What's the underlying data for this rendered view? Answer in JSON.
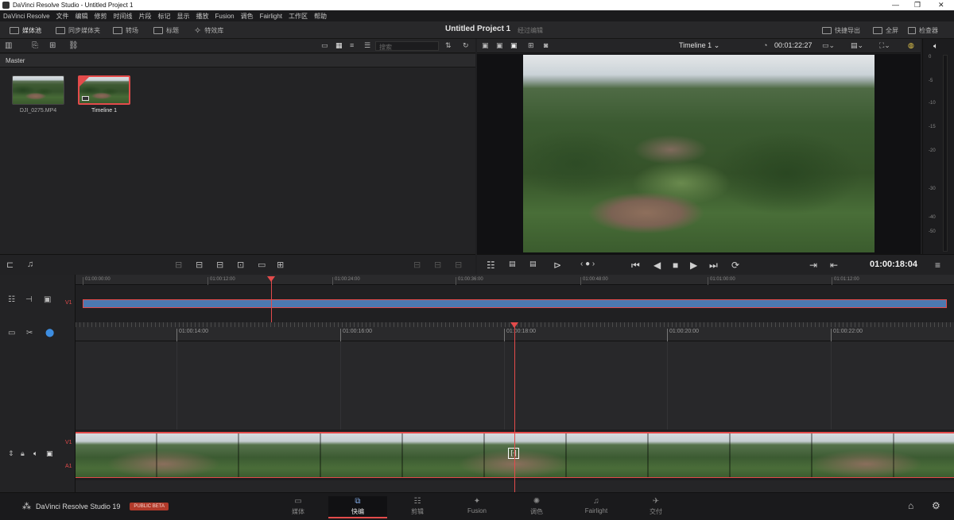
{
  "window": {
    "title": "DaVinci Resolve Studio - Untitled Project 1"
  },
  "menu": [
    "DaVinci Resolve",
    "文件",
    "编辑",
    "修剪",
    "时间线",
    "片段",
    "标记",
    "显示",
    "播放",
    "Fusion",
    "调色",
    "Fairlight",
    "工作区",
    "帮助"
  ],
  "toolbar": {
    "media_pool": "媒体池",
    "sync_bin": "同步媒体夹",
    "transitions": "转场",
    "titles": "标题",
    "effects": "特效库",
    "project_title": "Untitled Project 1",
    "project_sub": "经过编辑",
    "quick_export": "快捷导出",
    "fullscreen": "全屏",
    "inspector": "检查器"
  },
  "media_pool": {
    "search_placeholder": "搜索",
    "path": "Master",
    "clips": [
      {
        "name": "DJI_0275.MP4"
      },
      {
        "name": "Timeline 1"
      }
    ]
  },
  "viewer": {
    "timeline_name": "Timeline 1",
    "duration": "00:01:22:27",
    "timecode": "01:00:18:04",
    "scale": [
      "0",
      "-5",
      "-10",
      "-15",
      "-20",
      "-30",
      "-40",
      "-50"
    ]
  },
  "upper_timeline": {
    "track": "V1",
    "ticks": [
      "01:00:00:00",
      "01:00:12:00",
      "01:00:24:00",
      "01:00:36:00",
      "01:00:48:00",
      "01:01:00:00",
      "01:01:12:00"
    ]
  },
  "lower_timeline": {
    "video_track": "V1",
    "audio_track": "A1",
    "ticks": [
      "01:00:14:00",
      "01:00:16:00",
      "01:00:18:00",
      "01:00:20:00",
      "01:00:22:00"
    ]
  },
  "pages": {
    "brand": "DaVinci Resolve Studio 19",
    "beta": "PUBLIC BETA",
    "items": [
      {
        "label": "媒体",
        "icon": "media-page-icon"
      },
      {
        "label": "快编",
        "icon": "cut-page-icon"
      },
      {
        "label": "剪辑",
        "icon": "edit-page-icon"
      },
      {
        "label": "Fusion",
        "icon": "fusion-page-icon"
      },
      {
        "label": "调色",
        "icon": "color-page-icon"
      },
      {
        "label": "Fairlight",
        "icon": "fairlight-page-icon"
      },
      {
        "label": "交付",
        "icon": "deliver-page-icon"
      }
    ]
  },
  "colors": {
    "accent": "#e34b4b",
    "clip_blue": "#4d79b0"
  }
}
